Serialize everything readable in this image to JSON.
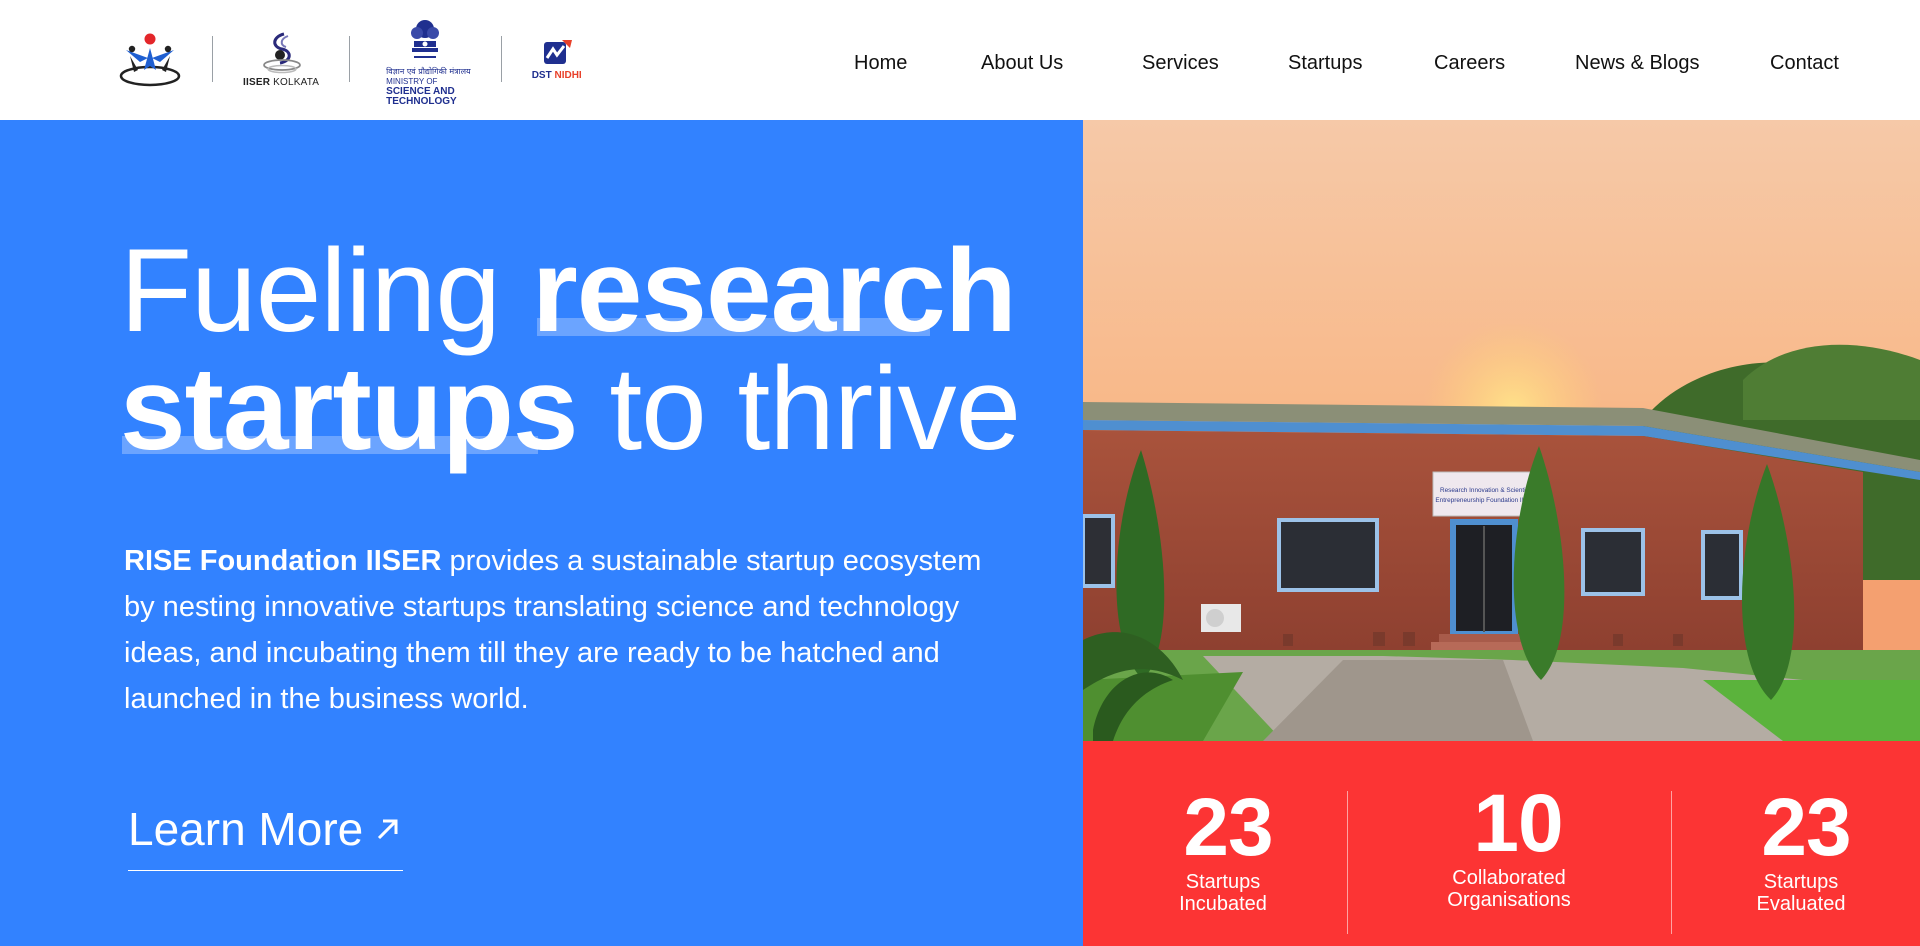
{
  "header": {
    "logos": [
      {
        "name": "rise-foundation-logo"
      },
      {
        "name": "iiser-kolkata-logo",
        "caption_bold": "IISER",
        "caption_thin": "KOLKATA"
      },
      {
        "name": "ministry-of-science-logo",
        "hindi": "विज्ञान एवं प्रौद्योगिकी मंत्रालय",
        "line1": "MINISTRY OF",
        "line2": "SCIENCE AND",
        "line3": "TECHNOLOGY"
      },
      {
        "name": "dst-nidhi-logo",
        "dst": "DST",
        "nidhi": "NIDHI"
      }
    ],
    "nav": [
      "Home",
      "About Us",
      "Services",
      "Startups",
      "Careers",
      "News & Blogs",
      "Contact"
    ]
  },
  "hero": {
    "headline": {
      "part1": "Fueling ",
      "part2_bold": "research",
      "part3_bold": "startups",
      "part4": " to thrive"
    },
    "description": {
      "bold": "RISE Foundation IISER",
      "text": " provides a sustainable startup ecosystem by nesting innovative startups translating science and technology ideas, and incubating them till they are ready to be hatched and launched in the business world."
    },
    "cta_label": "Learn More",
    "colors": {
      "primary_blue": "#3282ff",
      "stats_red": "#fc3434"
    }
  },
  "photo": {
    "sign_line1": "Research Innovation & Scientific",
    "sign_line2": "Entrepreneurship Foundation IISER"
  },
  "stats": [
    {
      "value": "23",
      "label_line1": "Startups",
      "label_line2": "Incubated"
    },
    {
      "value": "10",
      "label_line1": "Collaborated",
      "label_line2": "Organisations"
    },
    {
      "value": "23",
      "label_line1": "Startups",
      "label_line2": "Evaluated"
    }
  ]
}
